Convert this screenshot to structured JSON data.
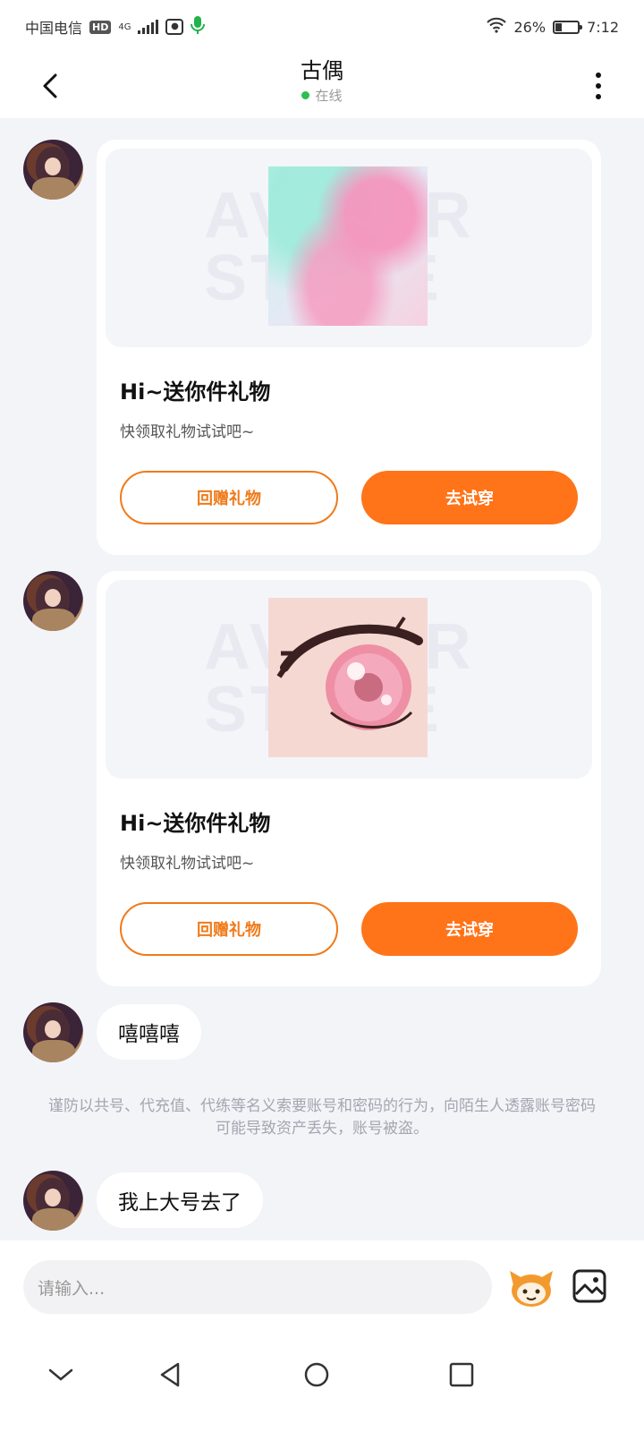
{
  "status_bar": {
    "carrier": "中国电信",
    "hd": "HD",
    "network": "4G",
    "battery_percent": "26%",
    "battery_level": 0.26,
    "time": "7:12"
  },
  "header": {
    "title": "古偶",
    "status": "在线",
    "status_color": "#2DBE4E",
    "back_icon": "chevron-left-icon",
    "more_icon": "more-vertical-icon"
  },
  "messages": [
    {
      "type": "gift",
      "title": "Hi~送你件礼物",
      "subtitle": "快领取礼物试试吧~",
      "return_label": "回赠礼物",
      "try_label": "去试穿"
    },
    {
      "type": "gift",
      "title": "Hi~送你件礼物",
      "subtitle": "快领取礼物试试吧~",
      "return_label": "回赠礼物",
      "try_label": "去试穿"
    },
    {
      "type": "text",
      "text": "嘻嘻嘻"
    },
    {
      "type": "text",
      "text": "我上大号去了"
    }
  ],
  "notice": "谨防以共号、代充值、代练等名义索要账号和密码的行为，向陌生人透露账号密码可能导致资产丢失，账号被盗。",
  "watermark": "AVATAR STORE",
  "input": {
    "placeholder": "请输入..."
  },
  "colors": {
    "accent": "#FF7418",
    "background": "#F3F4F8"
  }
}
